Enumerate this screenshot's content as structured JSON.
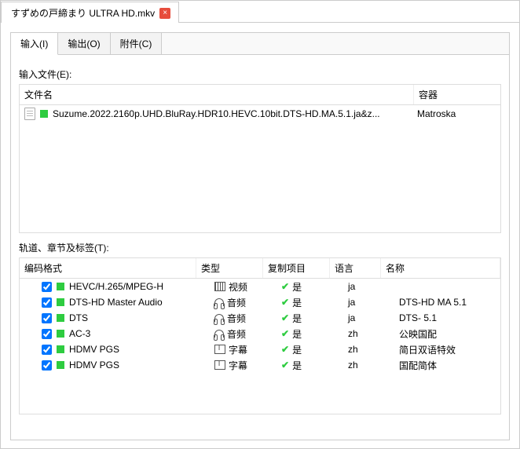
{
  "window": {
    "tab_title": "すずめの戸締まり ULTRA HD.mkv"
  },
  "panel_tabs": {
    "input": "输入(I)",
    "output": "输出(O)",
    "attachment": "附件(C)"
  },
  "input_section": {
    "label": "输入文件(E):",
    "headers": {
      "filename": "文件名",
      "container": "容器"
    },
    "file": {
      "name": "Suzume.2022.2160p.UHD.BluRay.HDR10.HEVC.10bit.DTS-HD.MA.5.1.ja&z...",
      "container": "Matroska"
    }
  },
  "tracks_section": {
    "label": "轨道、章节及标签(T):",
    "headers": {
      "codec": "编码格式",
      "type": "类型",
      "copy": "复制项目",
      "lang": "语言",
      "name": "名称"
    },
    "track_types": {
      "video": "视频",
      "audio": "音频",
      "subtitle": "字幕"
    },
    "copy_yes": "是",
    "rows": [
      {
        "codec": "HEVC/H.265/MPEG-H",
        "type": "video",
        "lang": "ja",
        "name": ""
      },
      {
        "codec": "DTS-HD Master Audio",
        "type": "audio",
        "lang": "ja",
        "name": "DTS-HD MA 5.1"
      },
      {
        "codec": "DTS",
        "type": "audio",
        "lang": "ja",
        "name": "DTS- 5.1"
      },
      {
        "codec": "AC-3",
        "type": "audio",
        "lang": "zh",
        "name": "公映国配"
      },
      {
        "codec": "HDMV PGS",
        "type": "subtitle",
        "lang": "zh",
        "name": "简日双语特效"
      },
      {
        "codec": "HDMV PGS",
        "type": "subtitle",
        "lang": "zh",
        "name": "国配简体"
      }
    ]
  }
}
